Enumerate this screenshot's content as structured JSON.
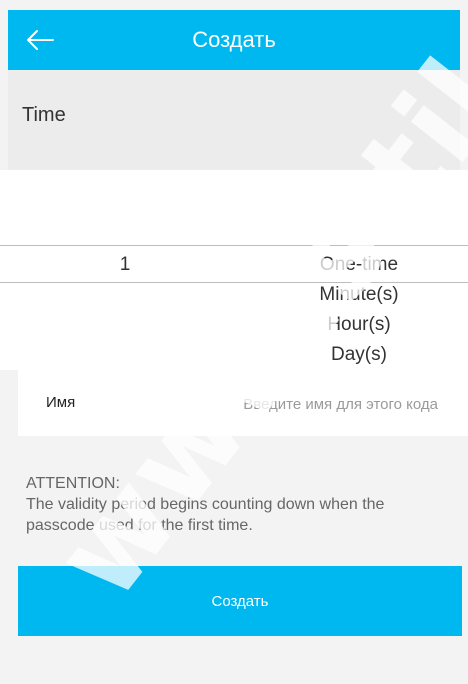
{
  "header": {
    "title": "Создать",
    "back_icon": "arrow-left-icon"
  },
  "time_section": {
    "label": "Time"
  },
  "picker": {
    "selected_number": "1",
    "units": [
      "One-time",
      "Minute(s)",
      "Hour(s)",
      "Day(s)"
    ]
  },
  "name_field": {
    "label": "Имя",
    "placeholder": "Введите имя для этого кода",
    "value": ""
  },
  "attention": {
    "title": "ATTENTION:",
    "text": "The validity period begins counting down when the passcode used for the first time."
  },
  "create_button": {
    "label": "Создать"
  },
  "watermark": {
    "text": "www.sitil"
  },
  "colors": {
    "accent": "#00b8f0",
    "background": "#f3f3f3"
  }
}
